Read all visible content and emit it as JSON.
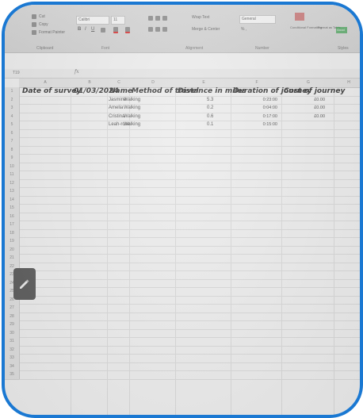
{
  "ribbon": {
    "clipboard": {
      "cut": "Cut",
      "copy": "Copy",
      "format_painter": "Format Painter",
      "group": "Clipboard"
    },
    "font": {
      "name": "Calibri",
      "size": "11",
      "group": "Font"
    },
    "alignment": {
      "wrap_text": "Wrap Text",
      "merge_center": "Merge & Center",
      "group": "Alignment"
    },
    "number": {
      "format": "General",
      "group": "Number"
    },
    "styles": {
      "conditional": "Conditional Formatting",
      "format_as_table": "Format as Table",
      "cell": "Good",
      "group": "Styles"
    }
  },
  "formula_bar": {
    "name_box": "T19",
    "fx": "fx",
    "content": ""
  },
  "sheet": {
    "columns": [
      "A",
      "B",
      "C",
      "D",
      "E",
      "F",
      "G",
      "H"
    ],
    "row_numbers": [
      "1",
      "2",
      "3",
      "4",
      "5",
      "6",
      "7",
      "8",
      "9",
      "10",
      "11",
      "12",
      "13",
      "14",
      "15",
      "16",
      "17",
      "18",
      "19",
      "20",
      "21",
      "22",
      "23",
      "24",
      "25",
      "26",
      "27",
      "28",
      "29",
      "30",
      "31",
      "32",
      "33",
      "34",
      "35"
    ],
    "cells": {
      "A1": "Date of survey",
      "B1": "01/03/2024",
      "C1": "Name",
      "D1": "Method of travel",
      "E1": "Distance in miles",
      "F1": "Duration of journey",
      "G1": "Cost of journey"
    },
    "rows": [
      {
        "name": "Jasmine",
        "method": "Walking",
        "distance": "5.3",
        "duration": "0:23:00",
        "cost": "£0.00"
      },
      {
        "name": "Amelia",
        "method": "Walking",
        "distance": "0.2",
        "duration": "0:04:00",
        "cost": "£0.00"
      },
      {
        "name": "Cristina",
        "method": "Walking",
        "distance": "0.6",
        "duration": "0:17:00",
        "cost": "£0.00"
      },
      {
        "name": "Leah-rose",
        "method": "Walking",
        "distance": "0.1",
        "duration": "0:15:00",
        "cost": ""
      }
    ]
  },
  "side_button": {
    "icon": "pencil-icon"
  }
}
